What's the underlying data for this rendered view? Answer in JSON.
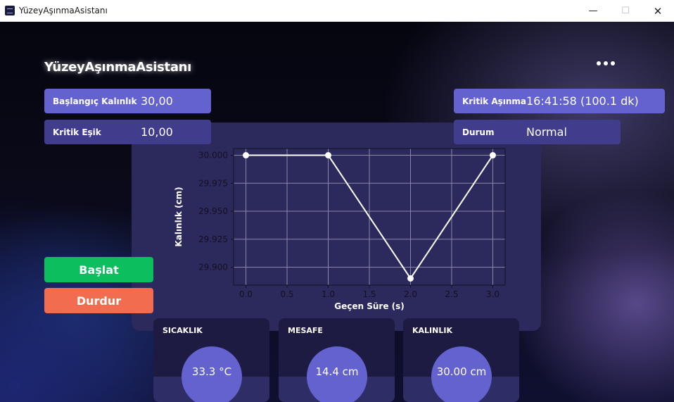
{
  "window": {
    "title": "YüzeyAşınmaAsistanı",
    "min_glyph": "—",
    "max_glyph": "☐",
    "close_glyph": "✕"
  },
  "app": {
    "heading": "YüzeyAşınmaAsistanı",
    "menu_icon": "more-horizontal-icon"
  },
  "fields": {
    "initial_thickness": {
      "label": "Başlangıç Kalınlık",
      "value": "30,00"
    },
    "critical_threshold": {
      "label": "Kritik Eşik",
      "value": "10,00"
    },
    "critical_wear": {
      "label": "Kritik Aşınma",
      "value": "16:41:58 (100.1 dk)"
    },
    "status": {
      "label": "Durum",
      "value": "Normal"
    }
  },
  "buttons": {
    "start": "Başlat",
    "stop": "Durdur"
  },
  "colors": {
    "accent": "#6462cf",
    "start": "#0dbe5e",
    "stop": "#f26d4f",
    "panel": "#2c2a5c"
  },
  "chart_data": {
    "type": "line",
    "xlabel": "Geçen Süre (s)",
    "ylabel": "Kalınlık (cm)",
    "x": [
      0.0,
      1.0,
      2.0,
      3.0
    ],
    "y": [
      30.0,
      30.0,
      29.89,
      30.0
    ],
    "xlim": [
      -0.15,
      3.15
    ],
    "ylim": [
      29.884,
      30.006
    ],
    "xticks": [
      "0.0",
      "0.5",
      "1.0",
      "1.5",
      "2.0",
      "2.5",
      "3.0"
    ],
    "yticks": [
      "29.900",
      "29.925",
      "29.950",
      "29.975",
      "30.000"
    ],
    "grid": true,
    "line_color": "#ffffff"
  },
  "cards": [
    {
      "title": "SICAKLIK",
      "value": "33.3 °C"
    },
    {
      "title": "MESAFE",
      "value": "14.4 cm"
    },
    {
      "title": "KALINLIK",
      "value": "30.00 cm"
    }
  ]
}
